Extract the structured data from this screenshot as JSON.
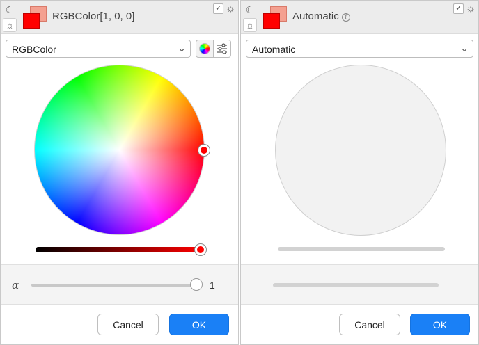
{
  "left_panel": {
    "title": "RGBColor[1, 0, 0]",
    "dropdown_value": "RGBColor",
    "alpha_label": "α",
    "alpha_value": "1",
    "alpha": 1,
    "selected_color": "#ff0000",
    "secondary_color": "#f4a090",
    "cancel_label": "Cancel",
    "ok_label": "OK"
  },
  "right_panel": {
    "title": "Automatic",
    "dropdown_value": "Automatic",
    "cancel_label": "Cancel",
    "ok_label": "OK"
  },
  "icons": {
    "dark_mode": "moon-icon",
    "light_mode": "sun-icon",
    "theme_toggle": "sun-moon-icon",
    "checkbox": "checkmark-icon",
    "wheel_tool": "color-wheel-icon",
    "sliders_tool": "sliders-icon",
    "dropdown": "chevron-down-icon",
    "info": "info-icon"
  },
  "colors": {
    "accent": "#1a80f6",
    "header_bg": "#ececec"
  }
}
